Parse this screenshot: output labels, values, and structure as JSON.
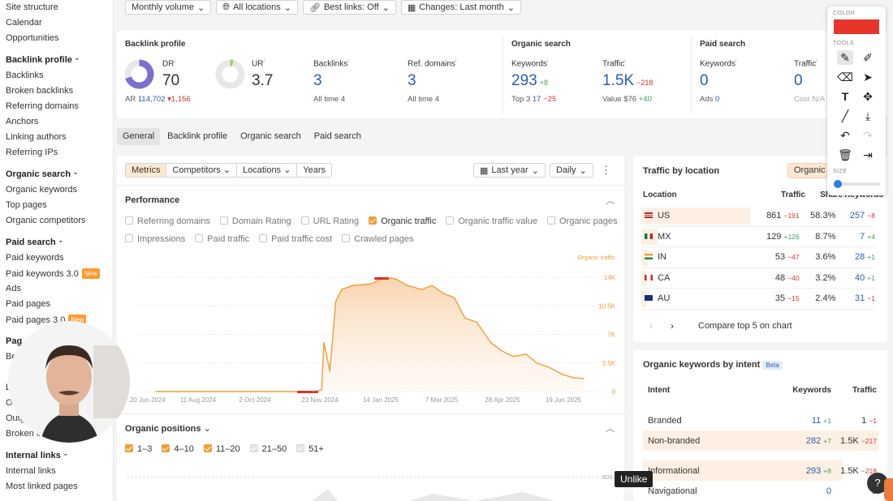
{
  "sidebar": {
    "top_items": [
      "Site structure",
      "Calendar",
      "Opportunities"
    ],
    "sections": [
      {
        "title": "Backlink profile",
        "items": [
          "Backlinks",
          "Broken backlinks",
          "Referring domains",
          "Anchors",
          "Linking authors",
          "Referring IPs"
        ]
      },
      {
        "title": "Organic search",
        "items": [
          "Organic keywords",
          "Top pages",
          "Organic competitors"
        ]
      },
      {
        "title": "Paid search",
        "items": [
          "Paid keywords",
          "Paid keywords 3.0",
          "Ads",
          "Paid pages",
          "Paid pages 3.0"
        ]
      },
      {
        "title": "Pag",
        "items": [
          "Be",
          "",
          "Li",
          "Out",
          "Outgoi",
          "Broken links"
        ]
      },
      {
        "title": "Internal links",
        "items": [
          "Internal links",
          "Most linked pages"
        ]
      }
    ],
    "badge_new": "New"
  },
  "filters": {
    "volume": "Monthly volume",
    "locations": "All locations",
    "best_links": "Best links: Off",
    "changes": "Changes: Last month"
  },
  "overview": {
    "backlink_title": "Backlink profile",
    "dr": {
      "label": "DR",
      "value": "70",
      "ar_label": "AR",
      "ar_value": "114,702",
      "ar_change": "▾1,156",
      "gauge": 0.7
    },
    "ur": {
      "label": "UR",
      "value": "3.7",
      "gauge": 0.037
    },
    "backlinks": {
      "label": "Backlinks",
      "value": "3",
      "sub": "All time",
      "sub_val": "4"
    },
    "ref_domains": {
      "label": "Ref. domains",
      "value": "3",
      "sub": "All time",
      "sub_val": "4"
    },
    "organic_title": "Organic search",
    "org_keywords": {
      "label": "Keywords",
      "value": "293",
      "change": "+8",
      "sub": "Top 3",
      "sub_val": "17",
      "sub_change": "−25"
    },
    "org_traffic": {
      "label": "Traffic",
      "value": "1.5K",
      "change": "−218",
      "sub": "Value",
      "sub_val": "$76",
      "sub_change": "+40"
    },
    "paid_title": "Paid search",
    "paid_keywords": {
      "label": "Keywords",
      "value": "0",
      "sub": "Ads",
      "sub_val": "0"
    },
    "paid_traffic": {
      "label": "Traffic",
      "value": "0",
      "sub": "Cost",
      "sub_val": "N/A"
    }
  },
  "tabs": [
    "General",
    "Backlink profile",
    "Organic search",
    "Paid search"
  ],
  "perf": {
    "seg": [
      "Metrics",
      "Competitors",
      "Locations",
      "Years"
    ],
    "range": "Last year",
    "interval": "Daily",
    "title": "Performance",
    "checks_row1": [
      {
        "label": "Referring domains",
        "checked": false
      },
      {
        "label": "Domain Rating",
        "checked": false
      },
      {
        "label": "URL Rating",
        "checked": false
      },
      {
        "label": "Organic traffic",
        "checked": true
      },
      {
        "label": "Organic traffic value",
        "checked": false
      },
      {
        "label": "Organic pages",
        "checked": false
      }
    ],
    "checks_row2": [
      {
        "label": "Impressions",
        "checked": false
      },
      {
        "label": "Paid traffic",
        "checked": false
      },
      {
        "label": "Paid traffic cost",
        "checked": false
      },
      {
        "label": "Crawled pages",
        "checked": false
      }
    ],
    "positions_title": "Organic positions",
    "positions": [
      {
        "label": "1–3",
        "checked": true
      },
      {
        "label": "4–10",
        "checked": true
      },
      {
        "label": "11–20",
        "checked": true
      },
      {
        "label": "21–50",
        "checked": false
      },
      {
        "label": "51+",
        "checked": false
      }
    ],
    "positions_axis": "800"
  },
  "chart_data": {
    "type": "area",
    "series": [
      {
        "name": "Organic traffic",
        "color": "#ef9f36"
      }
    ],
    "x_ticks": [
      "20 Jun 2024",
      "11 Aug 2024",
      "2 Oct 2024",
      "23 Nov 2024",
      "14 Jan 2025",
      "7 Mar 2025",
      "28 Apr 2025",
      "19 Jun 2025"
    ],
    "y_ticks": [
      "14K",
      "10.5K",
      "7K",
      "3.5K",
      "0"
    ],
    "ylim": [
      0,
      14000
    ],
    "x": [
      "2024-06-20",
      "2024-11-01",
      "2024-11-08",
      "2024-11-10",
      "2024-11-15",
      "2024-11-20",
      "2024-11-25",
      "2024-12-05",
      "2024-12-20",
      "2025-01-01",
      "2025-01-10",
      "2025-01-20",
      "2025-02-01",
      "2025-02-10",
      "2025-02-20",
      "2025-03-01",
      "2025-03-10",
      "2025-03-20",
      "2025-04-01",
      "2025-04-10",
      "2025-04-20",
      "2025-05-01",
      "2025-05-10",
      "2025-05-20",
      "2025-06-01",
      "2025-06-10",
      "2025-06-19"
    ],
    "y": [
      0,
      0,
      200,
      6000,
      2500,
      11000,
      12500,
      13000,
      13200,
      14000,
      13800,
      13000,
      12500,
      13000,
      12000,
      11500,
      9000,
      8500,
      6000,
      5000,
      4300,
      4600,
      3500,
      3000,
      2100,
      1700,
      1600
    ]
  },
  "traffic_location": {
    "title": "Traffic by location",
    "btn": "Organic",
    "headers": [
      "Location",
      "Traffic",
      "Share",
      "Keywords"
    ],
    "rows": [
      {
        "code": "US",
        "traffic": "861",
        "tchange": "−191",
        "share": "58.3%",
        "keywords": "257",
        "kchange": "−8",
        "pct": 0.583
      },
      {
        "code": "MX",
        "traffic": "129",
        "tchange": "+126",
        "share": "8.7%",
        "keywords": "7",
        "kchange": "+4",
        "pct": 0.087
      },
      {
        "code": "IN",
        "traffic": "53",
        "tchange": "−47",
        "share": "3.6%",
        "keywords": "28",
        "kchange": "+1",
        "pct": 0.036
      },
      {
        "code": "CA",
        "traffic": "48",
        "tchange": "−40",
        "share": "3.2%",
        "keywords": "40",
        "kchange": "+1",
        "pct": 0.032
      },
      {
        "code": "AU",
        "traffic": "35",
        "tchange": "−15",
        "share": "2.4%",
        "keywords": "31",
        "kchange": "−1",
        "pct": 0.024
      }
    ],
    "compare": "Compare top 5 on chart"
  },
  "intent": {
    "title": "Organic keywords by intent",
    "beta": "Beta",
    "headers": [
      "Intent",
      "Keywords",
      "Traffic"
    ],
    "rows": [
      {
        "name": "Branded",
        "kw": "11",
        "kwc": "+1",
        "tr": "1",
        "trc": "−1"
      },
      {
        "name": "Non-branded",
        "kw": "282",
        "kwc": "+7",
        "tr": "1.5K",
        "trc": "−217"
      },
      {
        "name": "Informational",
        "kw": "293",
        "kwc": "+8",
        "tr": "1.5K",
        "trc": "−218"
      },
      {
        "name": "Navigational",
        "kw": "0",
        "kwc": "",
        "tr": "0",
        "trc": ""
      }
    ]
  },
  "toolpanel": {
    "color_label": "COLOR",
    "tools_label": "TOOLS",
    "size_label": "SIZE",
    "color": "#e8352b"
  },
  "tooltip": "Unlike",
  "colors": {
    "accent": "#ef9f36",
    "link": "#2a5db0",
    "negative": "#d2342f",
    "positive": "#3aa35e"
  }
}
